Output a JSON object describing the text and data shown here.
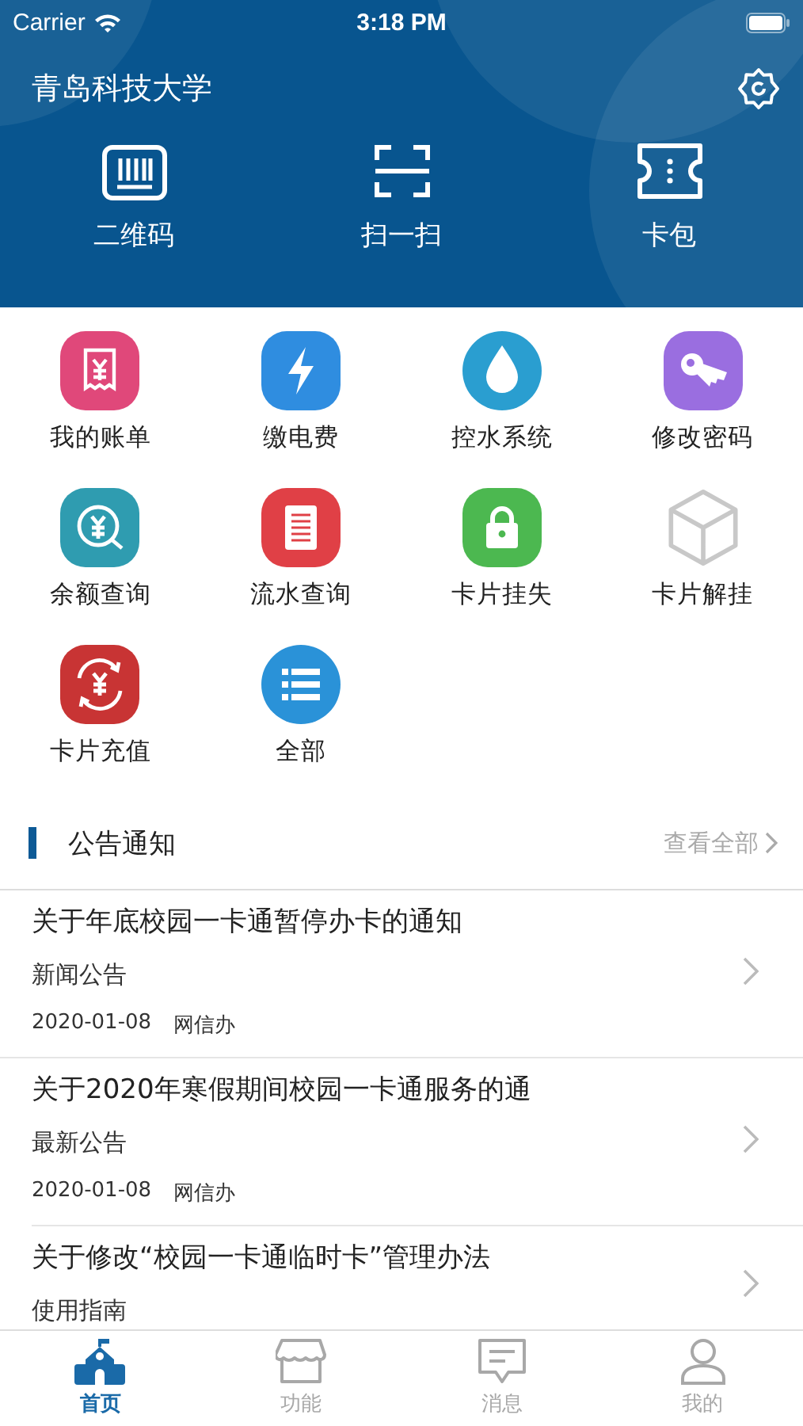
{
  "status_bar": {
    "carrier": "Carrier",
    "time": "3:18 PM"
  },
  "header": {
    "title": "青岛科技大学"
  },
  "quick_actions": [
    {
      "label": "二维码"
    },
    {
      "label": "扫一扫"
    },
    {
      "label": "卡包"
    }
  ],
  "functions": [
    {
      "label": "我的账单",
      "color": "#e0487a"
    },
    {
      "label": "缴电费",
      "color": "#2f8de0"
    },
    {
      "label": "控水系统",
      "color": "#2a9ed0"
    },
    {
      "label": "修改密码",
      "color": "#9a6ee0"
    },
    {
      "label": "余额查询",
      "color": "#2f9cb0"
    },
    {
      "label": "流水查询",
      "color": "#e04046"
    },
    {
      "label": "卡片挂失",
      "color": "#4cb850"
    },
    {
      "label": "卡片解挂",
      "color": "#c8c8c8"
    },
    {
      "label": "卡片充值",
      "color": "#c83434"
    },
    {
      "label": "全部",
      "color": "#2a92d8"
    }
  ],
  "notices": {
    "title": "公告通知",
    "view_all": "查看全部",
    "items": [
      {
        "title": "关于年底校园一卡通暂停办卡的通知",
        "category": "新闻公告",
        "date": "2020-01-08",
        "source": "网信办"
      },
      {
        "title": "关于2020年寒假期间校园一卡通服务的通",
        "category": "最新公告",
        "date": "2020-01-08",
        "source": "网信办"
      },
      {
        "title": "关于修改“校园一卡通临时卡”管理办法",
        "category": "使用指南"
      }
    ]
  },
  "tab_bar": [
    {
      "label": "首页",
      "selected": true
    },
    {
      "label": "功能",
      "selected": false
    },
    {
      "label": "消息",
      "selected": false
    },
    {
      "label": "我的",
      "selected": false
    }
  ]
}
